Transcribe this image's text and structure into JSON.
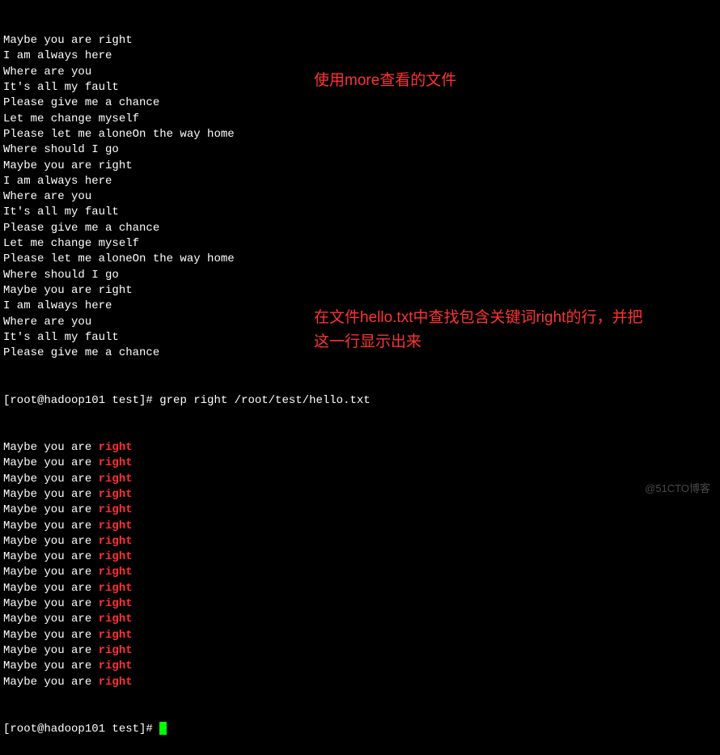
{
  "terminal": {
    "more_output": [
      "Maybe you are right",
      "I am always here",
      "Where are you",
      "It's all my fault",
      "Please give me a chance",
      "Let me change myself",
      "Please let me aloneOn the way home",
      "Where should I go",
      "Maybe you are right",
      "I am always here",
      "Where are you",
      "It's all my fault",
      "Please give me a chance",
      "Let me change myself",
      "Please let me aloneOn the way home",
      "Where should I go",
      "Maybe you are right",
      "I am always here",
      "Where are you",
      "It's all my fault",
      "Please give me a chance"
    ],
    "prompt1_user": "[root@hadoop101 test]# ",
    "prompt1_command": "grep right /root/test/hello.txt",
    "grep_output": {
      "prefix": "Maybe you are ",
      "match": "right",
      "count": 16
    },
    "prompt2_user": "[root@hadoop101 test]# "
  },
  "annotations": {
    "top": "使用more查看的文件",
    "bottom": "在文件hello.txt中查找包含关键词right的行，并把这一行显示出来"
  },
  "watermark": "@51CTO博客"
}
